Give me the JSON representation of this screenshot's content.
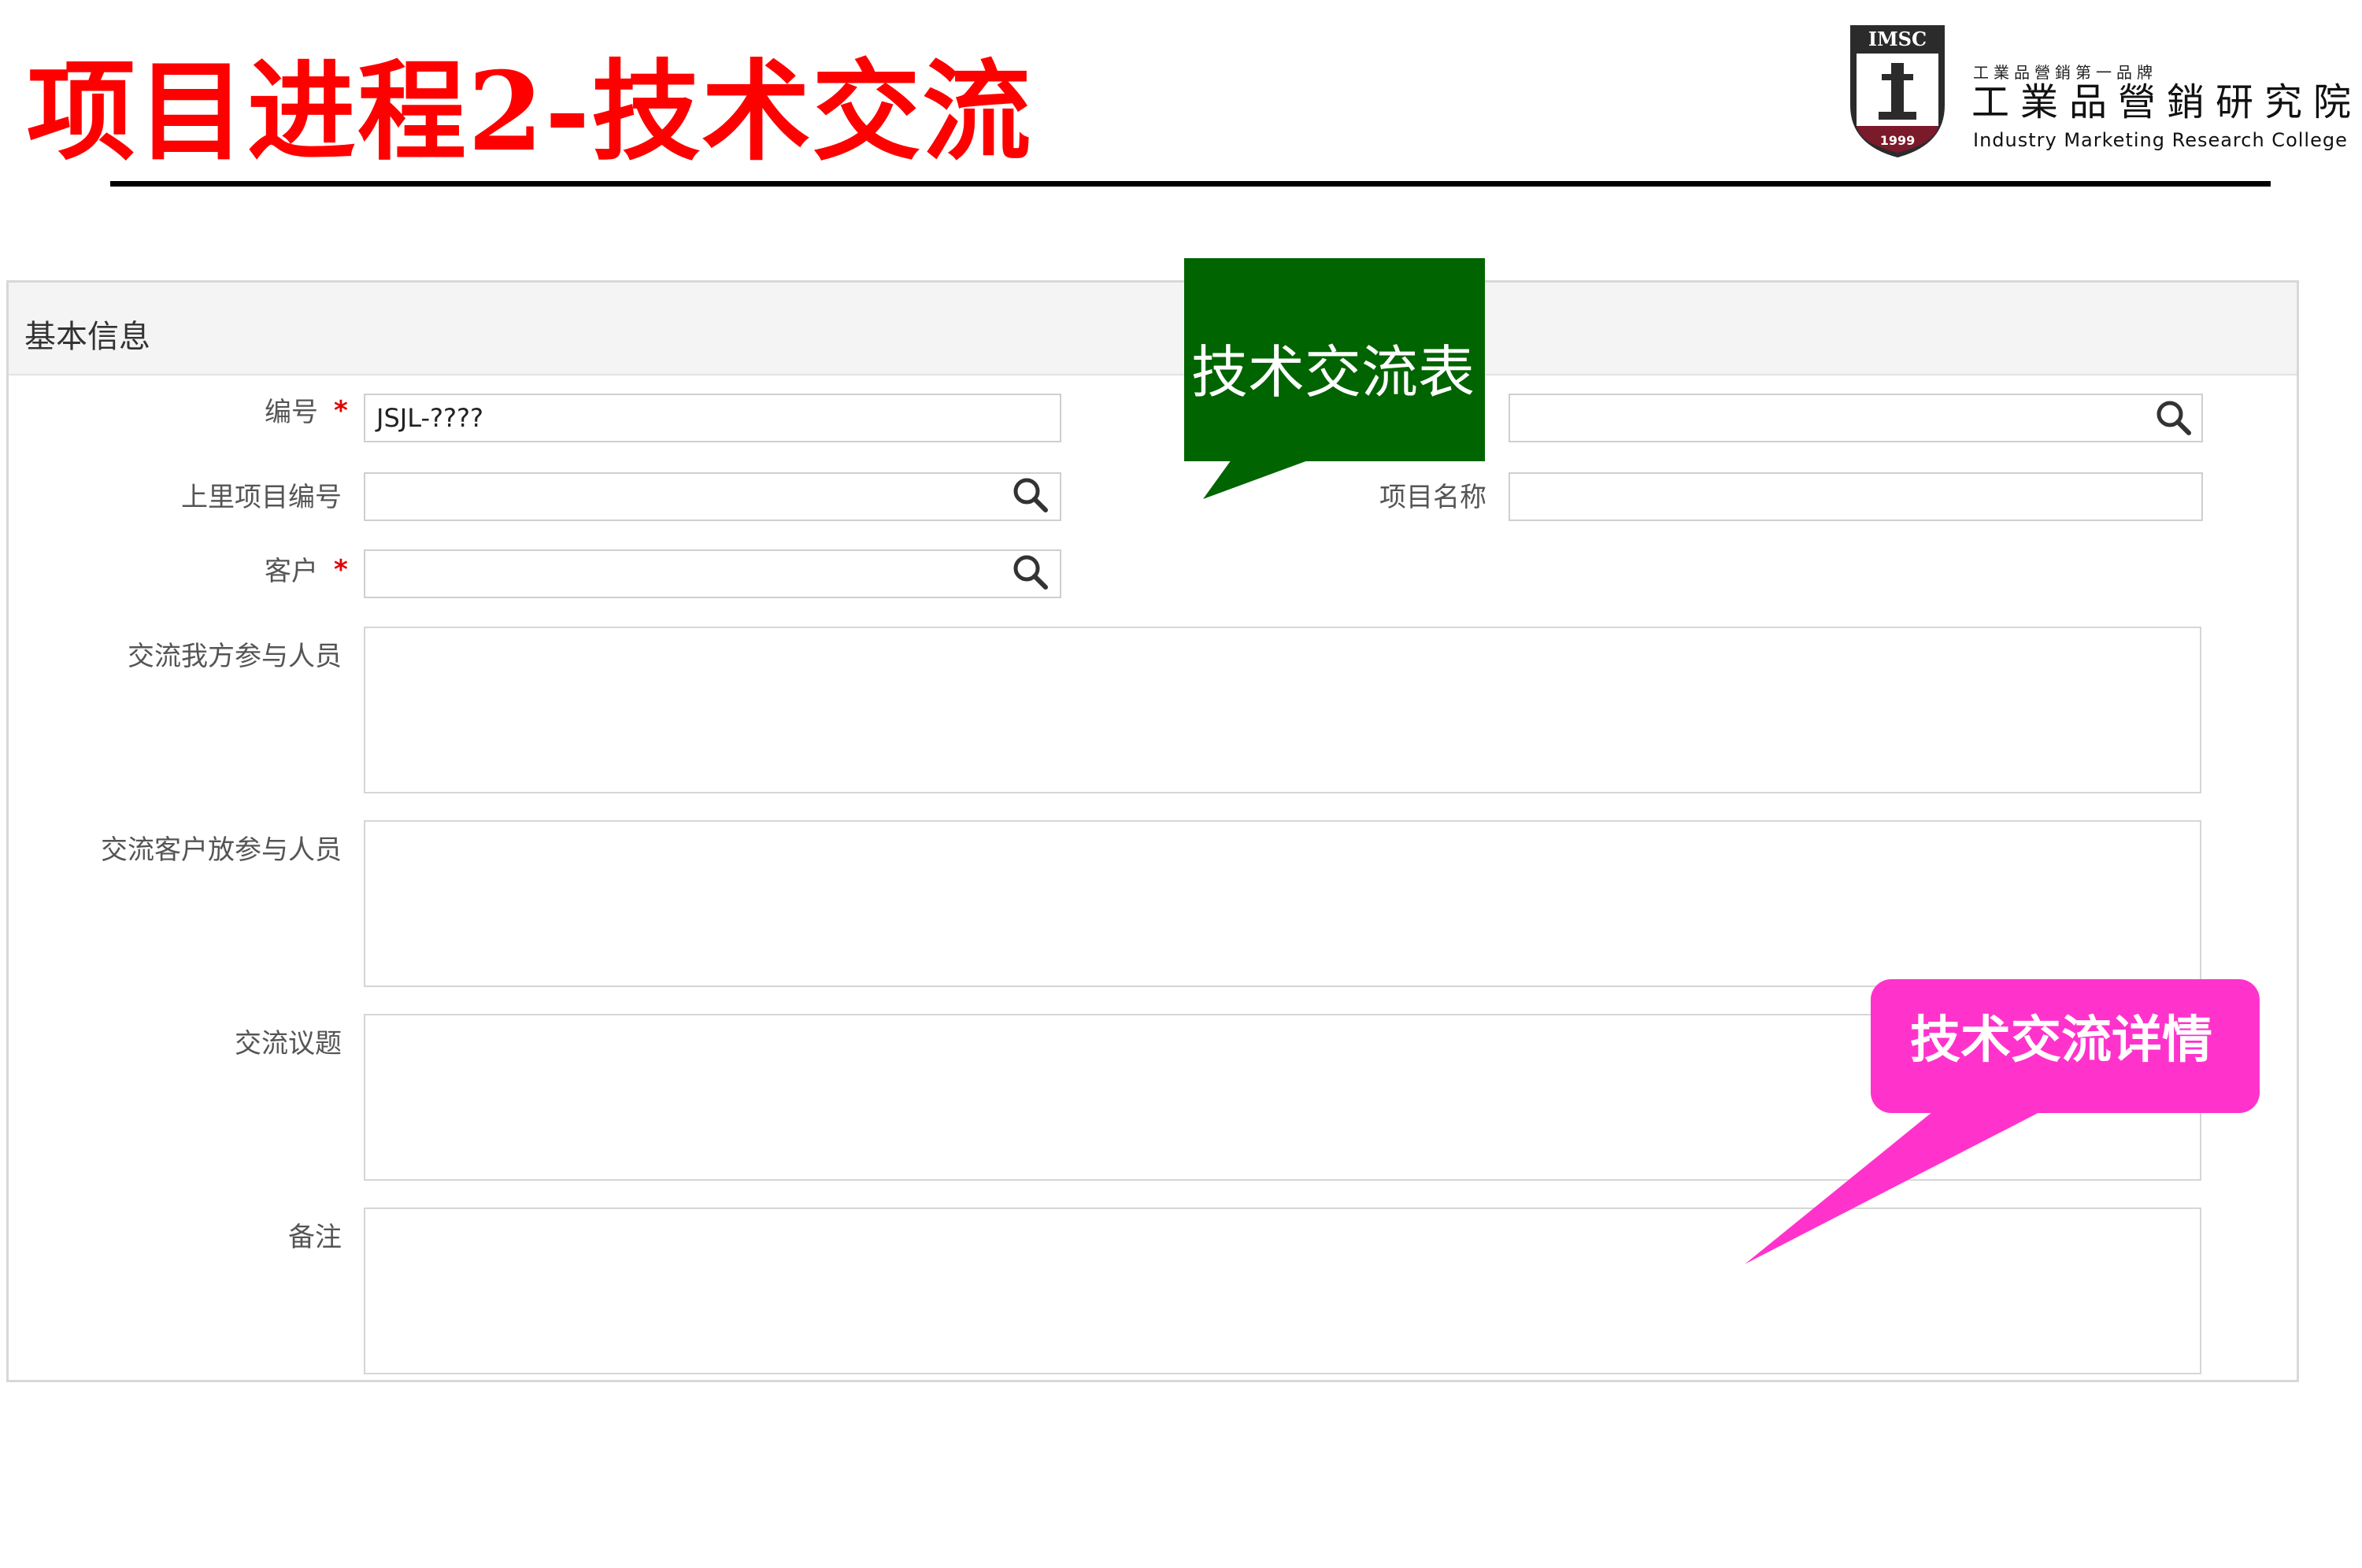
{
  "slide": {
    "title": "项目进程2-技术交流"
  },
  "logo": {
    "badge_text": "IMSC",
    "year": "1999",
    "tagline": "工業品營銷第一品牌",
    "name_cn": "工業品營銷研究院",
    "name_en": "Industry Marketing Research College"
  },
  "form": {
    "section_title": "基本信息",
    "fields": {
      "number": {
        "label": "编号",
        "value": "JSJL-????",
        "required": true
      },
      "top_right_lookup": {
        "value": ""
      },
      "parent_project_no": {
        "label": "上里项目编号",
        "value": ""
      },
      "project_name": {
        "label": "项目名称",
        "value": ""
      },
      "customer": {
        "label": "客户",
        "value": "",
        "required": true
      },
      "our_participants": {
        "label": "交流我方参与人员",
        "value": ""
      },
      "client_participants": {
        "label": "交流客户放参与人员",
        "value": ""
      },
      "topics": {
        "label": "交流议题",
        "value": ""
      },
      "remarks": {
        "label": "备注",
        "value": ""
      }
    },
    "required_marker": "*"
  },
  "callouts": {
    "form_name": {
      "text": "技术交流表",
      "color": "#006400"
    },
    "details": {
      "text": "技术交流详情",
      "color": "#ff33cc"
    }
  },
  "icons": [
    "search-icon"
  ]
}
